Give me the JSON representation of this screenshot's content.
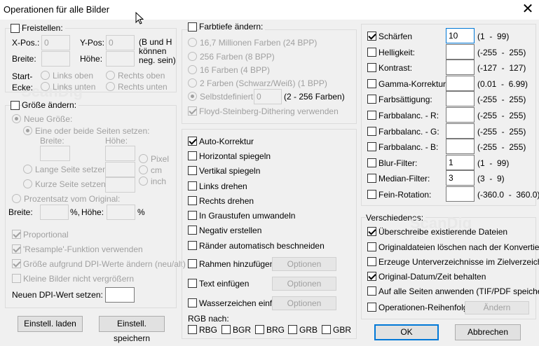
{
  "window": {
    "title": "Operationen für alle Bilder",
    "close_glyph": "✕"
  },
  "crop": {
    "label": "Freistellen:",
    "xpos_label": "X-Pos.:",
    "xpos_value": "0",
    "ypos_label": "Y-Pos:",
    "ypos_value": "0",
    "note": [
      "(B und H",
      "können",
      "neg. sein)"
    ],
    "width_label": "Breite:",
    "height_label": "Höhe:",
    "start_label": [
      "Start-",
      "Ecke:"
    ],
    "corners": [
      "Links oben",
      "Rechts oben",
      "Links unten",
      "Rechts unten"
    ]
  },
  "resize": {
    "label": "Größe ändern:",
    "new_size": "Neue Größe:",
    "one_or_both": "Eine oder beide Seiten setzen:",
    "width_label": "Breite:",
    "height_label": "Höhe:",
    "long_side": "Lange Seite setzen:",
    "short_side": "Kurze Seite setzen:",
    "units": [
      "Pixel",
      "cm",
      "inch"
    ],
    "percent_label": "Prozentsatz vom Original:",
    "pct_width_label": "Breite:",
    "pct_unit": "%,",
    "pct_height_label": "Höhe:",
    "pct_unit2": "%",
    "proportional": "Proportional",
    "resample": "'Resample'-Funktion verwenden",
    "dpi_resize": "Größe aufgrund DPI-Werte ändern (neu/alt)",
    "no_enlarge": "Kleine Bilder nicht vergrößern",
    "dpi_label": "Neuen DPI-Wert setzen:"
  },
  "buttons": {
    "load": "Einstell. laden",
    "save": "Einstell. speichern",
    "ok": "OK",
    "cancel": "Abbrechen",
    "options": "Optionen",
    "order_change": "Ändern"
  },
  "depth": {
    "label": "Farbtiefe ändern:",
    "options": [
      "16,7 Millionen Farben (24 BPP)",
      "256 Farben (8 BPP)",
      "16 Farben (4 BPP)",
      "2 Farben (Schwarz/Weiß) (1 BPP)",
      "Selbstdefiniert:"
    ],
    "custom_value": "0",
    "custom_range": "(2 - 256 Farben)",
    "dithering": "Floyd-Steinberg-Dithering verwenden"
  },
  "ops": {
    "items": [
      "Auto-Korrektur",
      "Horizontal spiegeln",
      "Vertikal spiegeln",
      "Links drehen",
      "Rechts drehen",
      "In Graustufen umwandeln",
      "Negativ erstellen",
      "Ränder automatisch beschneiden"
    ],
    "frame": "Rahmen hinzufügen",
    "text": "Text einfügen",
    "watermark": "Wasserzeichen einf.",
    "rgb_label": "RGB nach:",
    "rgb": [
      "RBG",
      "BGR",
      "BRG",
      "GRB",
      "GBR"
    ]
  },
  "adjust": [
    {
      "label": "Schärfen",
      "value": "10",
      "range": "(1  -  99)"
    },
    {
      "label": "Helligkeit:",
      "value": "",
      "range": "(-255  -  255)"
    },
    {
      "label": "Kontrast:",
      "value": "",
      "range": "(-127  -  127)"
    },
    {
      "label": "Gamma-Korrektur:",
      "value": "",
      "range": "(0.01  -  6.99)"
    },
    {
      "label": "Farbsättigung:",
      "value": "",
      "range": "(-255  -  255)"
    },
    {
      "label": "Farbbalanc. - R:",
      "value": "",
      "range": "(-255  -  255)"
    },
    {
      "label": "Farbbalanc. - G:",
      "value": "",
      "range": "(-255  -  255)"
    },
    {
      "label": "Farbbalanc. - B:",
      "value": "",
      "range": "(-255  -  255)"
    },
    {
      "label": "Blur-Filter:",
      "value": "1",
      "range": "(1  -  99)"
    },
    {
      "label": "Median-Filter:",
      "value": "3",
      "range": "(3  -  9)"
    },
    {
      "label": "Fein-Rotation:",
      "value": "",
      "range": "(-360.0  -  360.0)"
    }
  ],
  "misc": {
    "label": "Verschiedenes:",
    "items": [
      "Überschreibe existierende Dateien",
      "Originaldateien löschen nach der Konvertier.",
      "Erzeuge Unterverzeichnisse im Zielverzeichn.",
      "Original-Datum/Zeit behalten",
      "Auf alle Seiten anwenden (TIF/PDF speichern)",
      "Operationen-Reihenfolge"
    ]
  },
  "icons": {
    "cursor": "mouse-cursor-icon",
    "close": "close-icon"
  }
}
